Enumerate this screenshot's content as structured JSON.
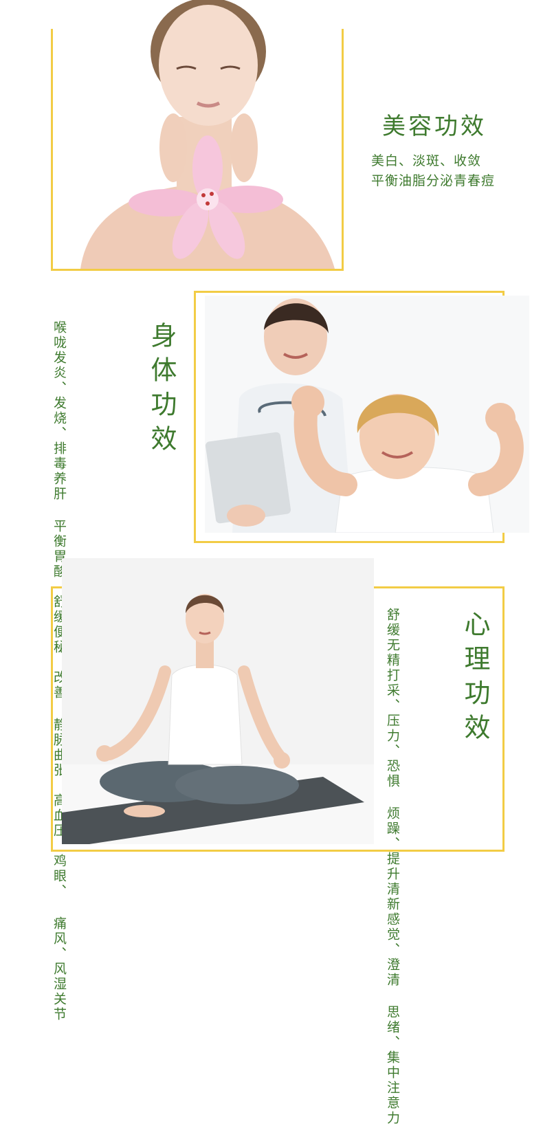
{
  "sections": {
    "beauty": {
      "title": "美容功效",
      "lines": [
        "美白、淡斑、收敛",
        "平衡油脂分泌青春痘"
      ],
      "photo_subject": "woman-with-lily"
    },
    "body": {
      "title": "身体功效",
      "lines": [
        "喉咙发炎、发烧、排毒养肝",
        "平衡胃酸、舒缓便秘、改善",
        "静脉曲张、高血压、鸡眼、",
        "痛风、风湿关节"
      ],
      "photo_subject": "doctor-and-boy"
    },
    "mind": {
      "title": "心理功效",
      "lines": [
        "舒缓无精打采、压力、恐惧",
        "烦躁、提升清新感觉、澄清",
        "思绪、集中注意力"
      ],
      "photo_subject": "woman-meditating"
    }
  },
  "colors": {
    "frame": "#f2cc45",
    "text": "#3e7a2e"
  }
}
